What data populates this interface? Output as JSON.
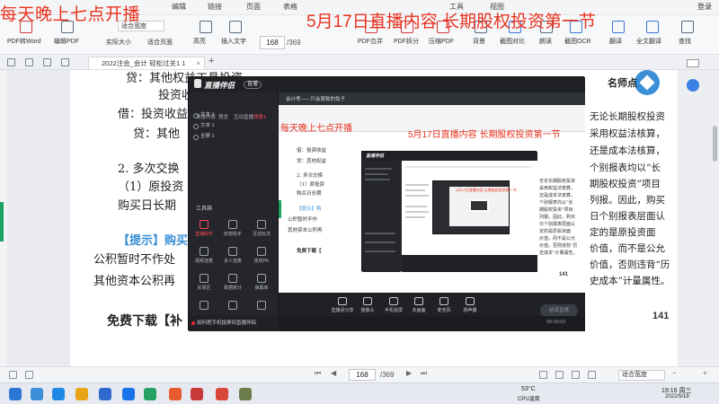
{
  "overlay": {
    "left": "每天晚上七点开播",
    "right": "5月17日直播内容 长期股权投资第一节"
  },
  "menubar": {
    "visible_item": "编辑",
    "item2": "链接",
    "item3": "页面",
    "item4": "表格",
    "item5": "工具",
    "item6": "视图",
    "login": "登录"
  },
  "ribbon": {
    "pdf_word": "PDF转Word",
    "edit_pdf": "编辑PDF",
    "zoom_combo": "适合宽度",
    "actual_size": "实际大小",
    "fit_page": "适合页面",
    "highlight": "高亮",
    "insert_text": "插入文字",
    "page_value": "168",
    "page_total": "/369",
    "pdf_merge": "PDF合并",
    "pdf_split": "PDF拆分",
    "compress": "压缩PDF",
    "background": "背景",
    "capture_compare": "截图对比",
    "read": "朗读",
    "ocr": "截图OCR",
    "translate": "翻译",
    "full_translate": "全文翻译",
    "search": "查找"
  },
  "tabbar": {
    "tab_label": "2022注会_会计 轻松过关1 1"
  },
  "document": {
    "lines": [
      "贷：其他权益工具投资",
      "投资收益",
      "借：投资收益",
      "贷：其他",
      "2. 多次交换",
      "（1）原投资",
      "购买日长期",
      "【提示】购买",
      "公积暂时不作处",
      "其他资本公积再",
      "免费下载【补"
    ],
    "teacher_label": "名师点",
    "right_lines": [
      "无论长期股权投资",
      "采用权益法核算，",
      "还是成本法核算，",
      "个别报表均以“长",
      "期股权投资”项目",
      "列报。因此，购买",
      "日个别报表层面认",
      "定的是原投资面",
      "价值，而不是公允",
      "价值，否则违背“历",
      "史成本”计量属性。"
    ],
    "page_number": "141"
  },
  "stream_app": {
    "brand": "直播伴侣",
    "live_tag": "直播",
    "tabs": [
      "场景内容",
      "预览",
      "互动直播",
      "场景1"
    ],
    "layers": [
      "文本 2",
      "文本 1",
      "全屏 1"
    ],
    "tools_heading": "工具箱",
    "tools": [
      {
        "label": "直播助手",
        "hot": true
      },
      {
        "label": "房管助手",
        "hot": false
      },
      {
        "label": "互动玩法",
        "hot": false
      },
      {
        "label": "视频连麦",
        "hot": false
      },
      {
        "label": "多人连麦",
        "hot": false
      },
      {
        "label": "连线PK",
        "hot": false
      },
      {
        "label": "反馈区",
        "hot": false
      },
      {
        "label": "数据统计",
        "hot": false
      },
      {
        "label": "弹幕库",
        "hot": false
      }
    ],
    "bottom_tip": "如何把手机投屏到直播伴侣",
    "preview": {
      "topbar": "会计考——只会算账的兔子",
      "overlay_left": "每天晚上七点开播",
      "overlay_right": "5月17日直播内容 长期股权投资第一节",
      "lines": [
        "借：投资收益",
        "贷：其他权益",
        "2. 多次交换",
        "（1）原投资",
        "购买日长期",
        "【提示】购",
        "公积暂时不作",
        "其他资本公积再",
        "免费下载【"
      ],
      "right_lines": [
        "无论长期股权投资",
        "采用权益法核算，",
        "还是成本法核算，",
        "个别报表均以“长",
        "期股权投资”项目",
        "列报。因此，购买",
        "日个别报表层面认",
        "定的是原投资面",
        "价值，而不是公允",
        "价值，否则违背“历",
        "史成本”计量属性。"
      ],
      "page_number": "141",
      "nested_overlay": "5月17日直播内容 长期股权投资第一节"
    },
    "controls": [
      {
        "label": "直播间分享"
      },
      {
        "label": "摄像头"
      },
      {
        "label": "手机投屏"
      },
      {
        "label": "多画面"
      },
      {
        "label": "麦克风"
      },
      {
        "label": "扬声器"
      }
    ],
    "start_button": "结束直播",
    "timer": "00:00:02"
  },
  "statusbar": {
    "page_value": "168",
    "page_total": "/369",
    "fit": "适合宽度"
  },
  "taskbar": {
    "weather_temp": "53°C",
    "weather_label": "CPU温度",
    "time": "19:16 周三",
    "date": "2022/5/18"
  }
}
